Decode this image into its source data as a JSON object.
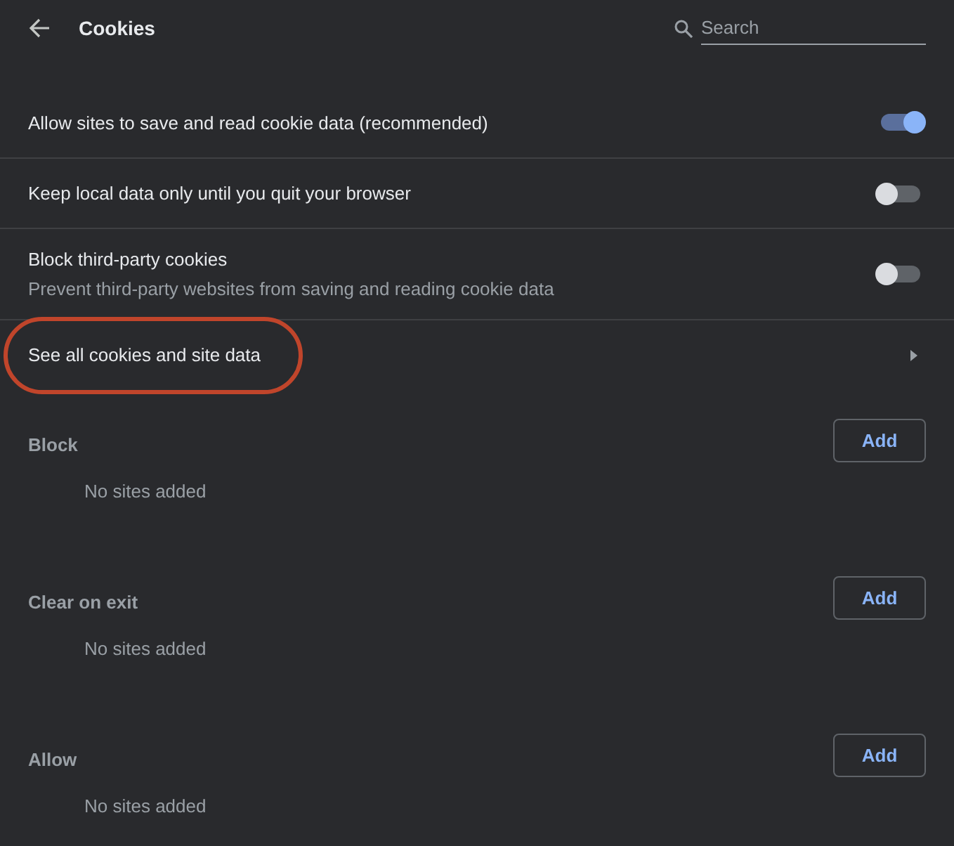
{
  "header": {
    "title": "Cookies",
    "search": {
      "placeholder": "Search"
    }
  },
  "settings": [
    {
      "kind": "toggle",
      "label": "Allow sites to save and read cookie data (recommended)",
      "on": true
    },
    {
      "kind": "toggle",
      "label": "Keep local data only until you quit your browser",
      "on": false
    },
    {
      "kind": "toggle",
      "label": "Block third-party cookies",
      "sublabel": "Prevent third-party websites from saving and reading cookie data",
      "on": false
    },
    {
      "kind": "link",
      "label": "See all cookies and site data",
      "highlighted": true
    }
  ],
  "sections": [
    {
      "title": "Block",
      "button": "Add",
      "empty_text": "No sites added"
    },
    {
      "title": "Clear on exit",
      "button": "Add",
      "empty_text": "No sites added"
    },
    {
      "title": "Allow",
      "button": "Add",
      "empty_text": "No sites added"
    }
  ]
}
